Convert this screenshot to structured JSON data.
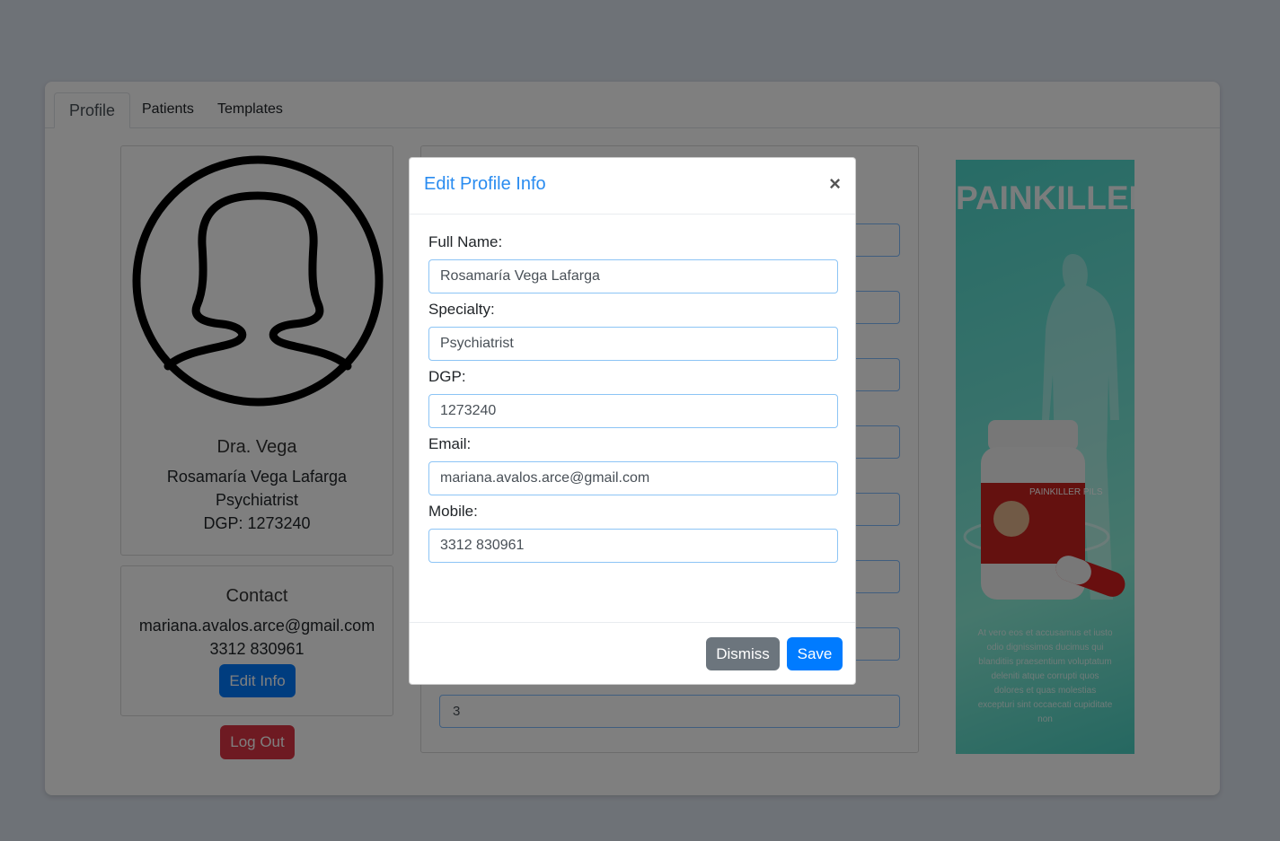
{
  "tabs": [
    "Profile",
    "Patients",
    "Templates"
  ],
  "profile": {
    "display_name": "Dra. Vega",
    "full_name": "Rosamaría Vega Lafarga",
    "specialty": "Psychiatrist",
    "dgp_line": "DGP: 1273240"
  },
  "contact": {
    "heading": "Contact",
    "email": "mariana.avalos.arce@gmail.com",
    "mobile": "3312 830961",
    "edit_button": "Edit Info"
  },
  "logout_button": "Log Out",
  "background_form": {
    "last_value": "3"
  },
  "ad": {
    "title": "PAINKILLER",
    "bottle_label": "PAINKILLER PILS",
    "small_text": "At vero eos et accusamus et iusto odio dignissimos ducimus qui blanditiis praesentium voluptatum deleniti atque corrupti quos dolores et quas molestias excepturi sint occaecati cupiditate non"
  },
  "modal": {
    "title": "Edit Profile Info",
    "close": "×",
    "fields": [
      {
        "label": "Full Name:",
        "value": "Rosamaría Vega Lafarga"
      },
      {
        "label": "Specialty:",
        "value": "Psychiatrist"
      },
      {
        "label": "DGP:",
        "value": "1273240"
      },
      {
        "label": "Email:",
        "value": "mariana.avalos.arce@gmail.com"
      },
      {
        "label": "Mobile:",
        "value": "3312 830961"
      }
    ],
    "dismiss": "Dismiss",
    "save": "Save"
  },
  "colors": {
    "primary": "#007bff",
    "secondary": "#6c757d",
    "danger": "#dc3545",
    "title_blue": "#2a8cf0"
  }
}
